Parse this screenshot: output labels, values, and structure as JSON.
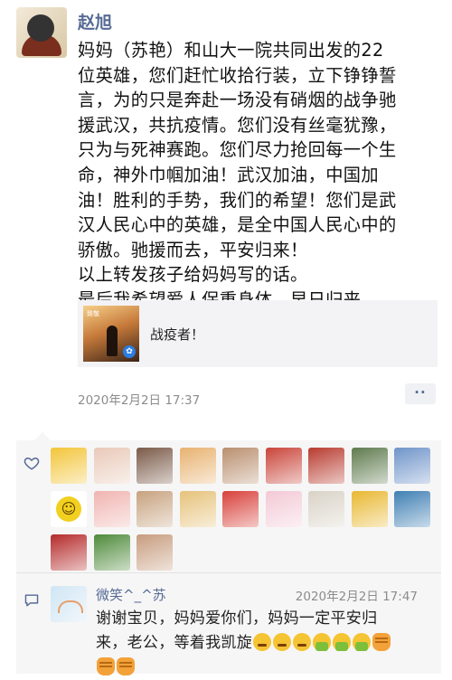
{
  "post": {
    "author": "赵旭",
    "text": "妈妈（苏艳）和山大一院共同出发的22\n位英雄，您们赶忙收拾行装，立下铮铮誓\n言，为的只是奔赴一场没有硝烟的战争驰\n援武汉，共抗疫情。您们没有丝毫犹豫，\n只为与死神赛跑。您们尽力抢回每一个生\n命，神外巾帼加油！武汉加油，中国加\n油！胜利的手势，我们的希望！您们是武\n汉人民心中的英雄，是全中国人民心中的\n骄傲。驰援而去，平安归来！\n以上转发孩子给妈妈写的话。\n最后我希望爱人保重身体，早日归来。",
    "share_card": {
      "title": "战疫者！",
      "thumb_text": "致敬"
    },
    "timestamp": "2020年2月2日 17:37",
    "more_label": "··"
  },
  "likes": {
    "icon": "heart-outline-icon",
    "avatars": [
      {
        "name": "chick",
        "color": "#f3c53a"
      },
      {
        "name": "hands-heart",
        "color": "#e9c9b8"
      },
      {
        "name": "man-portrait",
        "color": "#7a5a48"
      },
      {
        "name": "sunset-field",
        "color": "#e8b270"
      },
      {
        "name": "kid-portrait",
        "color": "#b98f6f"
      },
      {
        "name": "red-cartoon",
        "color": "#c9453a"
      },
      {
        "name": "red-bus",
        "color": "#b83b2f"
      },
      {
        "name": "man-outdoor",
        "color": "#5f7b4e"
      },
      {
        "name": "tower-sky",
        "color": "#6f94c9"
      },
      {
        "name": "smiley",
        "color": "#f2d020"
      },
      {
        "name": "baby-girl",
        "color": "#f0b4b0"
      },
      {
        "name": "boy-portrait",
        "color": "#c7a27f"
      },
      {
        "name": "gift-box",
        "color": "#e6c27a"
      },
      {
        "name": "red-flower",
        "color": "#d8403a"
      },
      {
        "name": "anime-girl",
        "color": "#f3c9d6"
      },
      {
        "name": "flower-sketch",
        "color": "#d9d2c6"
      },
      {
        "name": "yellow-balloons",
        "color": "#e9b832"
      },
      {
        "name": "palm-beach",
        "color": "#3f7fb3"
      },
      {
        "name": "red-poster",
        "color": "#b52a2a"
      },
      {
        "name": "green-field",
        "color": "#4e8a3a"
      },
      {
        "name": "couple-photo",
        "color": "#c79c7e"
      }
    ]
  },
  "comment": {
    "icon": "comment-icon",
    "name": "微笑^_^苏",
    "time": "2020年2月2日 17:47",
    "text_line1": "谢谢宝贝，妈妈爱你们，妈妈一定平安归",
    "text_line2": "来，老公，等着我凯旋"
  }
}
